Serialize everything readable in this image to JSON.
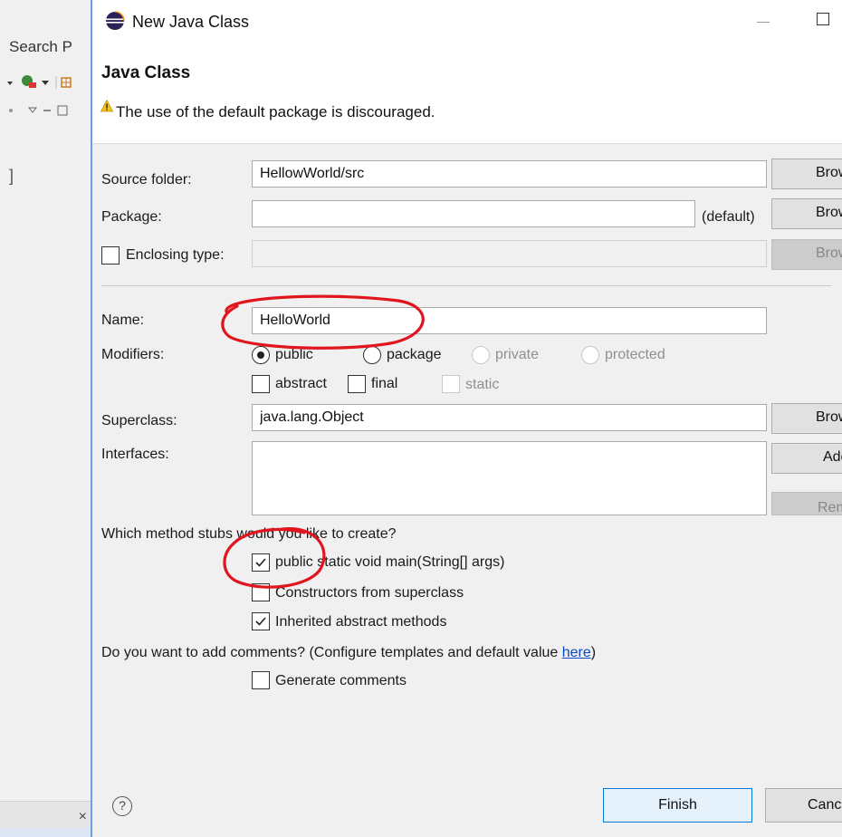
{
  "ide": {
    "menu_text": "Search P",
    "bracket": "]"
  },
  "dialog": {
    "title": "New Java Class",
    "header_title": "Java Class",
    "warning": "The use of the default package is discouraged.",
    "source_folder": {
      "label": "Source folder:",
      "value": "HellowWorld/src",
      "button": "Browse..."
    },
    "package": {
      "label": "Package:",
      "value": "",
      "suffix": "(default)",
      "button": "Browse..."
    },
    "enclosing_type": {
      "label": "Enclosing type:",
      "value": "",
      "checked": false,
      "button": "Browse..."
    },
    "name": {
      "label": "Name:",
      "value": "HelloWorld"
    },
    "modifiers": {
      "label": "Modifiers:",
      "radios": [
        {
          "label": "public",
          "selected": true,
          "enabled": true
        },
        {
          "label": "package",
          "selected": false,
          "enabled": true
        },
        {
          "label": "private",
          "selected": false,
          "enabled": false
        },
        {
          "label": "protected",
          "selected": false,
          "enabled": false
        }
      ],
      "checkboxes": [
        {
          "label": "abstract",
          "checked": false,
          "enabled": true
        },
        {
          "label": "final",
          "checked": false,
          "enabled": true
        },
        {
          "label": "static",
          "checked": false,
          "enabled": false
        }
      ]
    },
    "superclass": {
      "label": "Superclass:",
      "value": "java.lang.Object",
      "button": "Browse..."
    },
    "interfaces": {
      "label": "Interfaces:",
      "add_button": "Add...",
      "remove_button": "Remove"
    },
    "stubs": {
      "question": "Which method stubs would you like to create?",
      "options": [
        {
          "label": "public static void main(String[] args)",
          "checked": true
        },
        {
          "label": "Constructors from superclass",
          "checked": false
        },
        {
          "label": "Inherited abstract methods",
          "checked": true
        }
      ]
    },
    "comments": {
      "question_prefix": "Do you want to add comments? (Configure templates and default value ",
      "link": "here",
      "question_suffix": ")",
      "option": {
        "label": "Generate comments",
        "checked": false
      }
    },
    "footer": {
      "help": "?",
      "finish": "Finish",
      "cancel": "Cancel"
    }
  },
  "colors": {
    "annotation_red": "#e0151e",
    "finish_border": "#0078d7",
    "link": "#0b47c9"
  }
}
